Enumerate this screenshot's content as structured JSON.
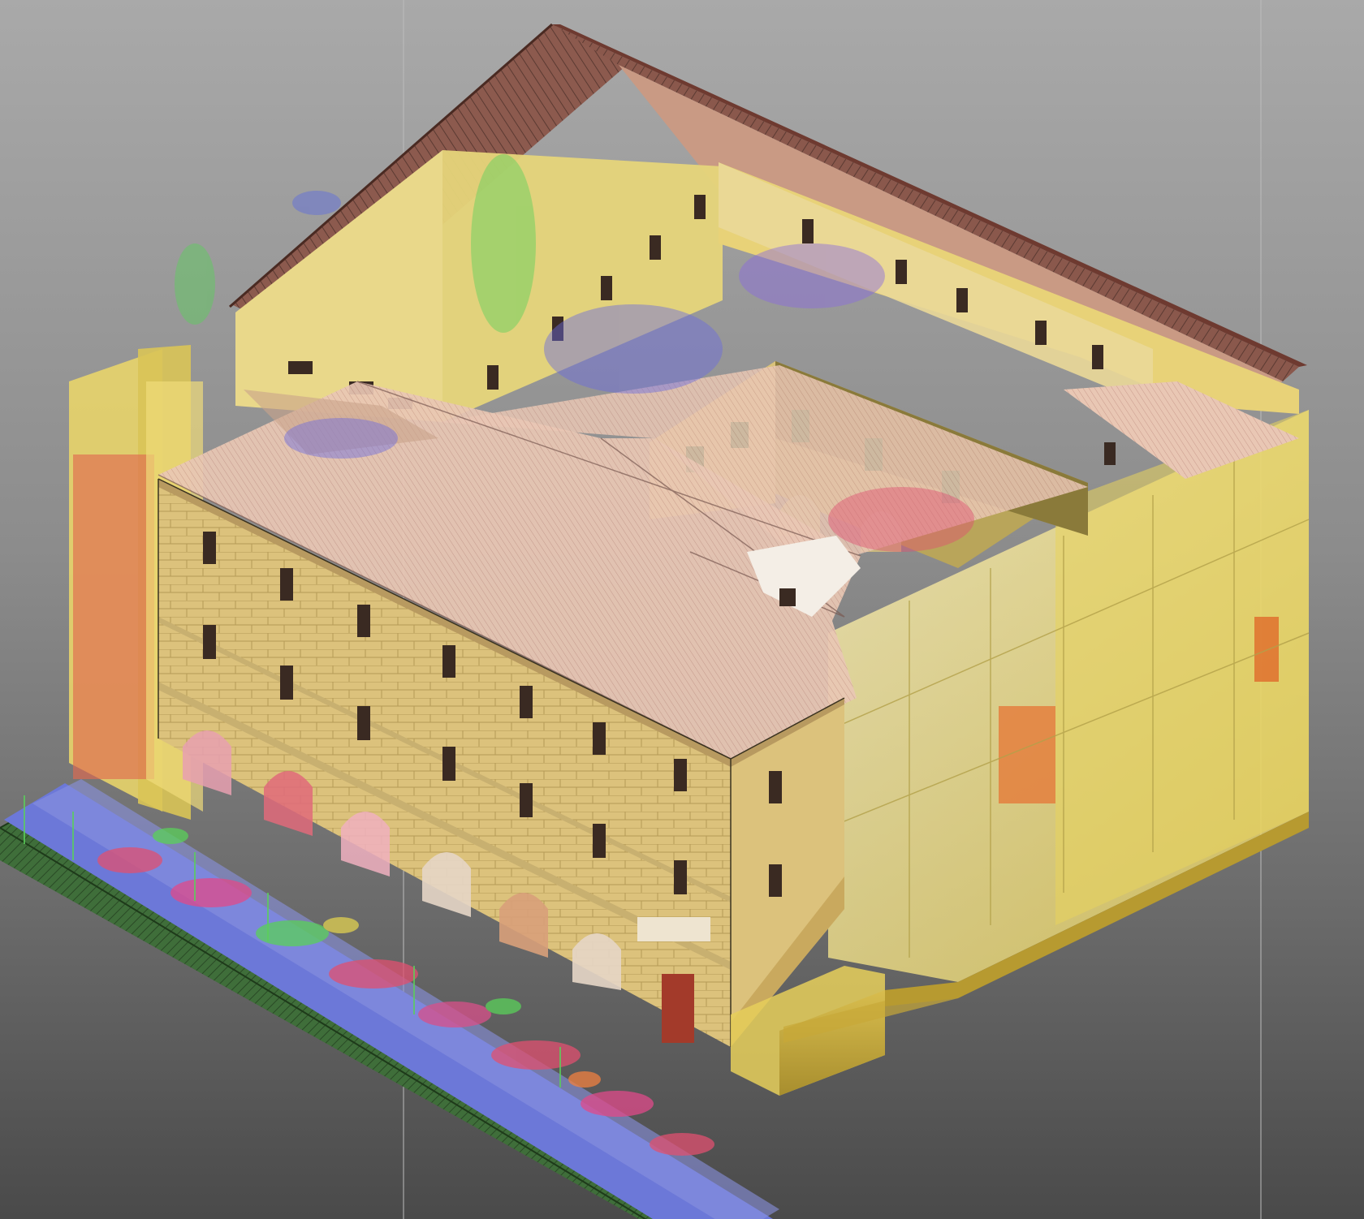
{
  "scene": {
    "colors": {
      "background_top": "#a9a9a9",
      "background_bottom": "#4a4a4a",
      "roof": "#8c5a4e",
      "roof_light": "#b98a78",
      "facade": "#d9c27a",
      "facade_shadow": "#c9a95e",
      "transparent_volume": "#f2e27a",
      "volume_dark": "#c8a838",
      "sidewalk": "#6c78d8",
      "ground_band": "#3f6e3a",
      "window": "#3a2a22",
      "door": "#a33a2a",
      "courtyard_wall": "#9a8a4a",
      "shutter": "#2f6a2f",
      "pointcloud_red": "#e0506a",
      "pointcloud_green": "#5ad05a",
      "pointcloud_blue": "#5a6ae0"
    },
    "icons": {
      "building": "building-icon"
    }
  }
}
